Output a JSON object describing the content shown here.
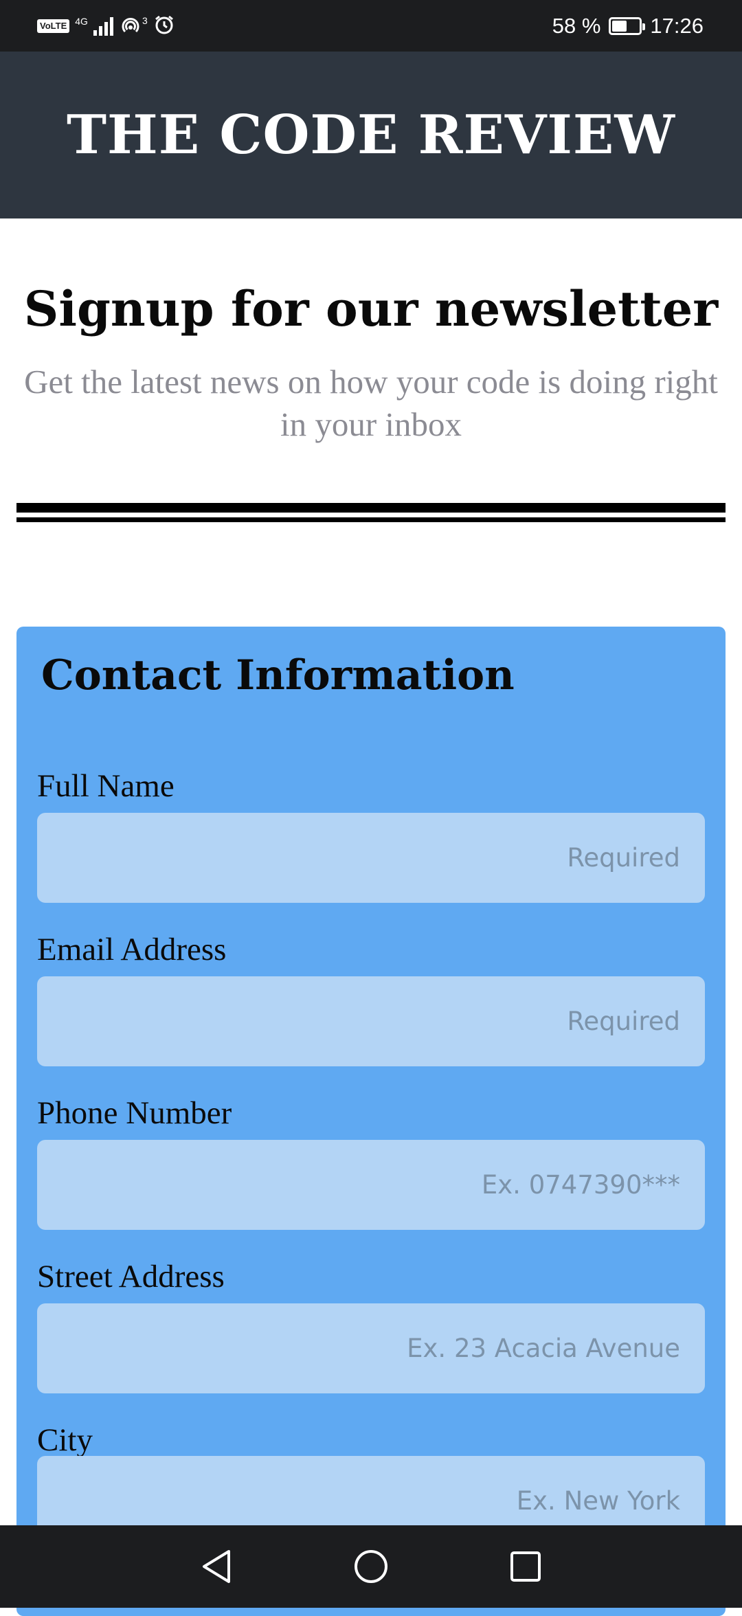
{
  "status_bar": {
    "volte": "VoLTE",
    "network_type": "4G",
    "hotspot_sup": "3",
    "battery_text": "58 %",
    "battery_level": 0.58,
    "time": "17:26"
  },
  "header": {
    "title": "THE CODE REVIEW"
  },
  "signup": {
    "title": "Signup for our newsletter",
    "subtitle": "Get the latest news on how your code is doing right in your inbox"
  },
  "form": {
    "title": "Contact Information",
    "fields": [
      {
        "label": "Full Name",
        "placeholder": "Required",
        "value": ""
      },
      {
        "label": "Email Address",
        "placeholder": "Required",
        "value": ""
      },
      {
        "label": "Phone Number",
        "placeholder": "Ex. 0747390***",
        "value": ""
      },
      {
        "label": "Street Address",
        "placeholder": "Ex. 23 Acacia Avenue",
        "value": ""
      },
      {
        "label": "City",
        "placeholder": "Ex. New York",
        "value": ""
      }
    ]
  },
  "colors": {
    "header_bg": "#2e3640",
    "form_bg": "#5fa9f2",
    "input_bg": "#b3d4f5",
    "subtitle": "#8b8b93"
  },
  "icons": {
    "nav_back": "triangle-back-icon",
    "nav_home": "circle-home-icon",
    "nav_recents": "square-recents-icon"
  }
}
